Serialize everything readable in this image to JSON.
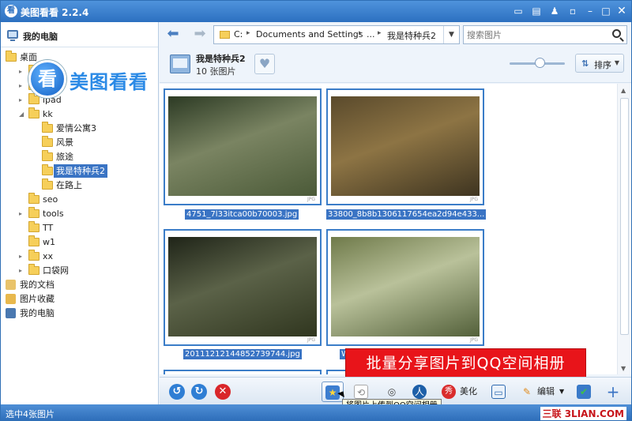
{
  "window": {
    "title": "美图看看 2.2.4"
  },
  "sidebar": {
    "root_label": "我的电脑",
    "logo_text": "美图看看",
    "logo_glyph": "看",
    "tree": [
      {
        "label": "桌面",
        "depth": 0,
        "arrow": "",
        "icon": "folder"
      },
      {
        "label": "",
        "depth": 1,
        "arrow": "▸",
        "icon": "folder"
      },
      {
        "label": "",
        "depth": 1,
        "arrow": "▸",
        "icon": "folder"
      },
      {
        "label": "ipad",
        "depth": 1,
        "arrow": "▸",
        "icon": "folder"
      },
      {
        "label": "kk",
        "depth": 1,
        "arrow": "◢",
        "icon": "folder"
      },
      {
        "label": "爱情公寓3",
        "depth": 2,
        "arrow": "",
        "icon": "folder"
      },
      {
        "label": "风景",
        "depth": 2,
        "arrow": "",
        "icon": "folder"
      },
      {
        "label": "旅途",
        "depth": 2,
        "arrow": "",
        "icon": "folder"
      },
      {
        "label": "我是特种兵2",
        "depth": 2,
        "arrow": "",
        "icon": "folder",
        "selected": true
      },
      {
        "label": "在路上",
        "depth": 2,
        "arrow": "",
        "icon": "folder"
      },
      {
        "label": "seo",
        "depth": 1,
        "arrow": "",
        "icon": "folder"
      },
      {
        "label": "tools",
        "depth": 1,
        "arrow": "▸",
        "icon": "folder"
      },
      {
        "label": "TT",
        "depth": 1,
        "arrow": "",
        "icon": "folder"
      },
      {
        "label": "w1",
        "depth": 1,
        "arrow": "",
        "icon": "folder"
      },
      {
        "label": "xx",
        "depth": 1,
        "arrow": "▸",
        "icon": "folder"
      },
      {
        "label": "口袋网",
        "depth": 1,
        "arrow": "▸",
        "icon": "folder"
      },
      {
        "label": "我的文档",
        "depth": 0,
        "arrow": "",
        "icon": "documents"
      },
      {
        "label": "图片收藏",
        "depth": 0,
        "arrow": "",
        "icon": "favorites"
      },
      {
        "label": "我的电脑",
        "depth": 0,
        "arrow": "",
        "icon": "computer"
      }
    ]
  },
  "address": {
    "segments": [
      "C:",
      "Documents and Settings",
      "...",
      "我是特种兵2"
    ],
    "search_placeholder": "搜索图片"
  },
  "album": {
    "title": "我是特种兵2",
    "count": "10 张图片",
    "sort_label": "排序"
  },
  "thumbnails": [
    {
      "caption": "4751_7l33itca00b70003.jpg",
      "badge": "JPG",
      "colors": [
        "#2c3a24",
        "#7a8462",
        "#4b5a38"
      ]
    },
    {
      "caption": "33800_8b8b1306117654ea2d94e433...",
      "badge": "JPG",
      "colors": [
        "#5a4a2c",
        "#8d7444",
        "#3e3420"
      ]
    },
    {
      "caption": "20111212144852739744.jpg",
      "badge": "JPG",
      "colors": [
        "#1f2418",
        "#5b6248",
        "#30361f"
      ]
    },
    {
      "caption": "W",
      "badge": "JPG",
      "colors": [
        "#6f7a4a",
        "#b9c19a",
        "#53603a"
      ]
    }
  ],
  "promo_banner": "批量分享图片到QQ空间相册",
  "toolbar": {
    "beautify_label": "美化",
    "edit_label": "编辑",
    "tooltip": "将图片上传到QQ空间相册"
  },
  "status": {
    "text": "选中4张图片",
    "watermark": "三联 3LIAN.COM"
  },
  "colors": {
    "title_bar": "#2c70c0",
    "selection": "#3a74c4",
    "promo": "#e8141a"
  }
}
